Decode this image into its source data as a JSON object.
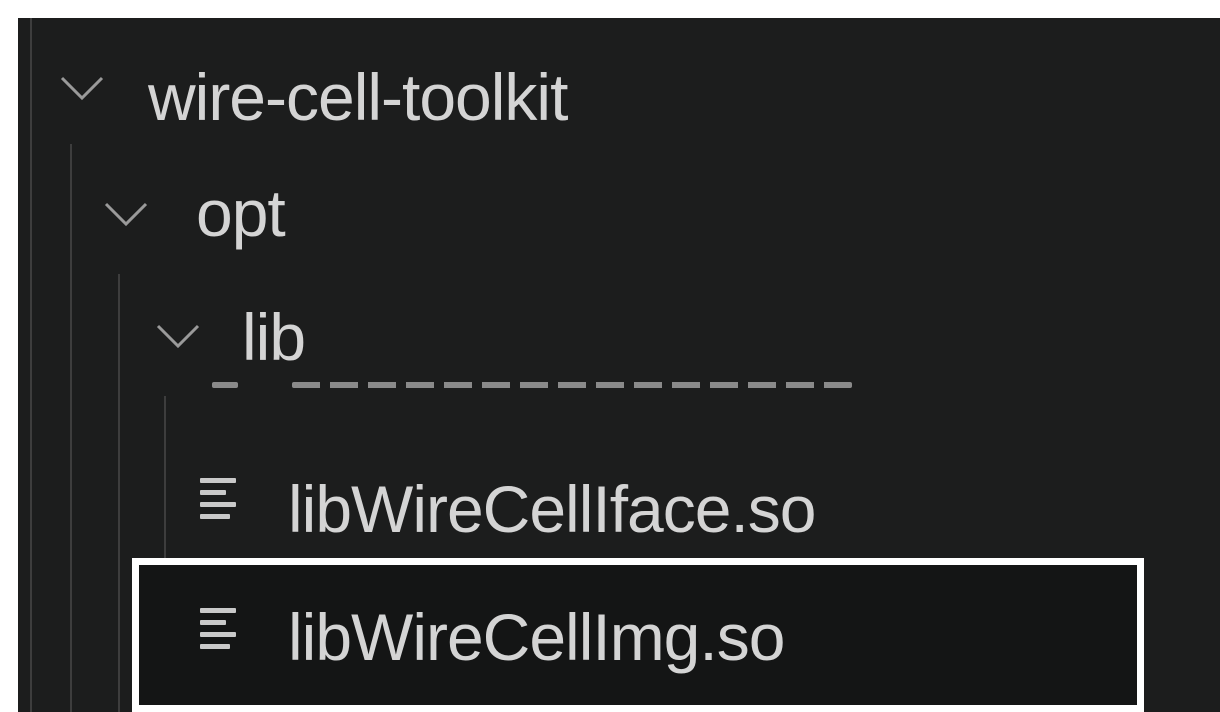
{
  "explorer": {
    "root": {
      "label": "wire-cell-toolkit",
      "expanded": true,
      "icon": "chevron-down-icon"
    },
    "opt": {
      "label": "opt",
      "expanded": true,
      "icon": "chevron-down-icon"
    },
    "lib": {
      "label": "lib",
      "expanded": true,
      "icon": "chevron-down-icon"
    },
    "files": [
      {
        "label": "libWireCellIface.so",
        "icon": "file-text-icon",
        "selected": false
      },
      {
        "label": "libWireCellImg.so",
        "icon": "file-text-icon",
        "selected": true
      }
    ]
  },
  "colors": {
    "background": "#1c1d1d",
    "text": "#d4d4d4",
    "indent_guide": "#3d3d3d",
    "selection_border": "#ffffff"
  }
}
